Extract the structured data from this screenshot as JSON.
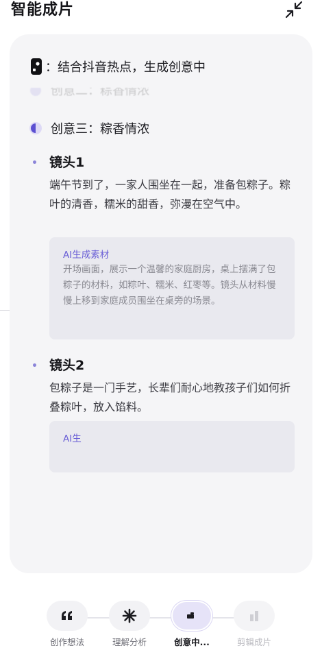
{
  "header": {
    "title": "智能成片",
    "collapse_icon": "collapse-arrows-icon"
  },
  "status": {
    "text": "：结合抖音热点，生成创意中",
    "icon": "douyin-logo-icon"
  },
  "ideas": {
    "previous_partial": "创意二：粽香情浓",
    "current": "创意三：粽香情浓"
  },
  "shots": [
    {
      "title": "镜头1",
      "description": "端午节到了，一家人围坐在一起，准备包粽子。粽叶的清香，糯米的甜香，弥漫在空气中。",
      "ai_label": "AI生成素材",
      "ai_text": "开场画面，展示一个温馨的家庭厨房，桌上摆满了包粽子的材料，如粽叶、糯米、红枣等。镜头从材料慢慢上移到家庭成员围坐在桌旁的场景。"
    },
    {
      "title": "镜头2",
      "description": "包粽子是一门手艺，长辈们耐心地教孩子们如何折叠粽叶，放入馅料。",
      "ai_label": "AI生",
      "ai_text": ""
    }
  ],
  "nav": {
    "items": [
      {
        "label": "创作想法",
        "icon": "quote-icon",
        "state": "done"
      },
      {
        "label": "理解分析",
        "icon": "asterisk-icon",
        "state": "done"
      },
      {
        "label": "创意中...",
        "icon": "idea-icon",
        "state": "active"
      },
      {
        "label": "剪辑成片",
        "icon": "chart-bars-icon",
        "state": "disabled"
      }
    ]
  },
  "colors": {
    "accent": "#6a5fd6",
    "card_bg": "#f5f5f7",
    "ai_box_bg": "#e9e9ef"
  }
}
